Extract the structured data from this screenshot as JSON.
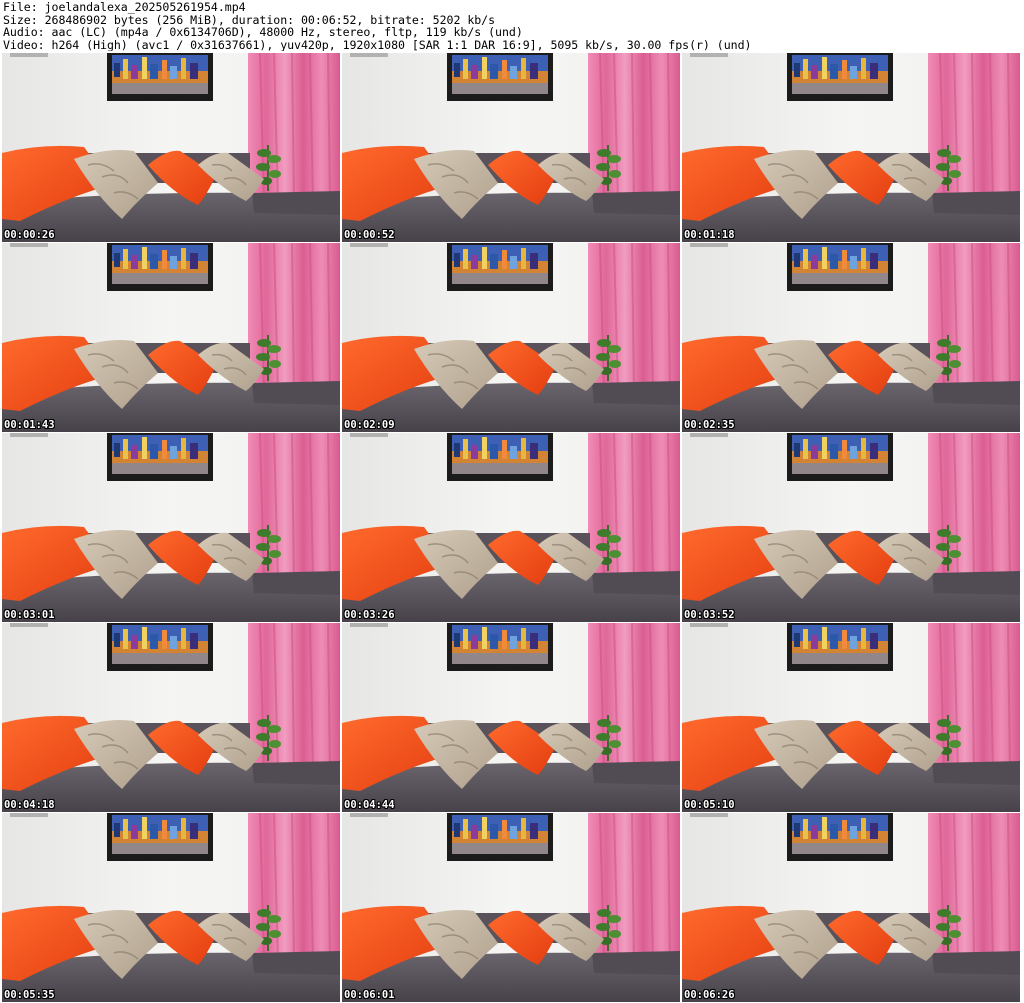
{
  "header": {
    "line1": "File: joelandalexa_202505261954.mp4",
    "line2": "Size: 268486902 bytes (256 MiB), duration: 00:06:52, bitrate: 5202 kb/s",
    "line3": "Audio: aac (LC) (mp4a / 0x6134706D), 48000 Hz, stereo, fltp, 119 kb/s (und)",
    "line4": "Video: h264 (High) (avc1 / 0x31637661), yuv420p, 1920x1080 [SAR 1:1 DAR 16:9], 5095 kb/s, 30.00 fps(r) (und)"
  },
  "thumbnails": [
    {
      "timestamp": "00:00:26"
    },
    {
      "timestamp": "00:00:52"
    },
    {
      "timestamp": "00:01:18"
    },
    {
      "timestamp": "00:01:43"
    },
    {
      "timestamp": "00:02:09"
    },
    {
      "timestamp": "00:02:35"
    },
    {
      "timestamp": "00:03:01"
    },
    {
      "timestamp": "00:03:26"
    },
    {
      "timestamp": "00:03:52"
    },
    {
      "timestamp": "00:04:18"
    },
    {
      "timestamp": "00:04:44"
    },
    {
      "timestamp": "00:05:10"
    },
    {
      "timestamp": "00:05:35"
    },
    {
      "timestamp": "00:06:01"
    },
    {
      "timestamp": "00:06:26"
    }
  ],
  "colors": {
    "wall": "#f1f1ef",
    "curtain": "#e86b9e",
    "sofa": "#5c565c",
    "orange_pillow": "#ff4d1a",
    "patterned_pillow": "#c6b8a4",
    "frame": "#1b1b1b",
    "plant": "#3e7c2c"
  }
}
